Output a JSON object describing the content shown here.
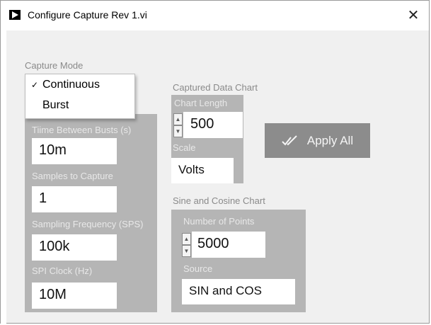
{
  "window": {
    "title": "Configure Capture Rev 1.vi",
    "close_glyph": "✕"
  },
  "capture_mode": {
    "label": "Capture Mode",
    "options": [
      {
        "label": "Continuous",
        "checked": true
      },
      {
        "label": "Burst",
        "checked": false
      }
    ],
    "check_glyph": "✓"
  },
  "time_between_bursts": {
    "label": "Tiime Between Busts (s)",
    "value": "10m"
  },
  "samples_to_capture": {
    "label": "Samples to Capture",
    "value": "1"
  },
  "sampling_frequency": {
    "label": "Sampling Frequency (SPS)",
    "value": "100k"
  },
  "spi_clock": {
    "label": "SPI Clock (Hz)",
    "value": "10M"
  },
  "captured_data_chart": {
    "label": "Captured Data Chart",
    "chart_length": {
      "label": "Chart Length",
      "value": "500"
    },
    "scale": {
      "label": "Scale",
      "value": "Volts"
    }
  },
  "apply_all": {
    "label": "Apply All",
    "icon": "double-check-icon"
  },
  "sine_cosine_chart": {
    "label": "Sine and Cosine Chart",
    "number_of_points": {
      "label": "Number of Points",
      "value": "5000"
    },
    "source": {
      "label": "Source",
      "value": "SIN and COS"
    }
  },
  "colors": {
    "panel": "#b5b5b5",
    "button": "#8c8c8c",
    "background": "#f0f0f0"
  }
}
